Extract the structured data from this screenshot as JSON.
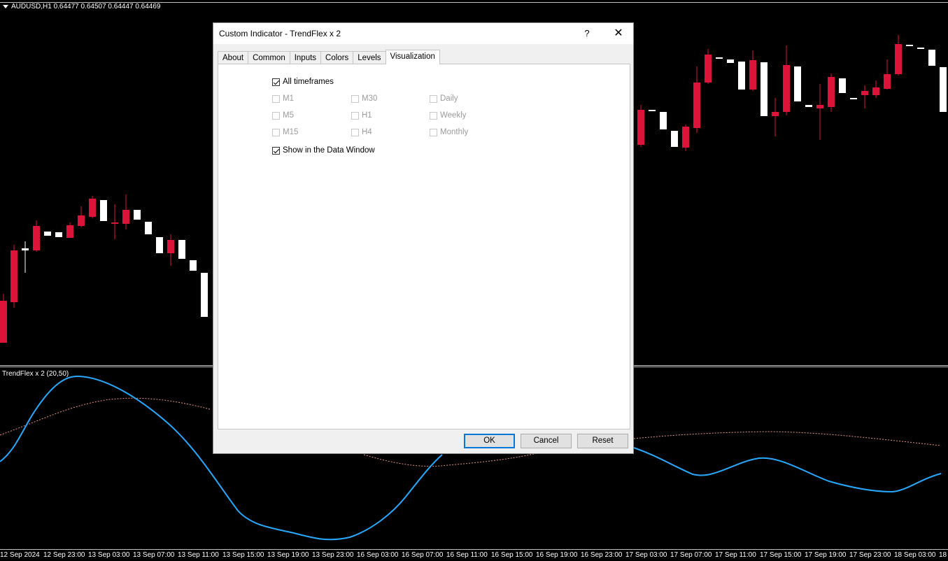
{
  "chart": {
    "symbol_label": "AUDUSD,H1  0.64477 0.64507 0.64447 0.64469",
    "indicator_label": "TrendFlex x 2 (20,50)",
    "x_ticks": [
      "12 Sep 2024",
      "12 Sep 23:00",
      "13 Sep 03:00",
      "13 Sep 07:00",
      "13 Sep 11:00",
      "13 Sep 15:00",
      "13 Sep 19:00",
      "13 Sep 23:00",
      "16 Sep 03:00",
      "16 Sep 07:00",
      "16 Sep 11:00",
      "16 Sep 15:00",
      "16 Sep 19:00",
      "16 Sep 23:00",
      "17 Sep 03:00",
      "17 Sep 07:00",
      "17 Sep 11:00",
      "17 Sep 15:00",
      "17 Sep 19:00",
      "17 Sep 23:00",
      "18 Sep 03:00",
      "18"
    ],
    "colors": {
      "bull": "#ffffff",
      "bear": "#dc143c",
      "line1": "#1e90ff",
      "line2": "#e9967a",
      "background": "#000000"
    }
  },
  "dialog": {
    "title": "Custom Indicator - TrendFlex x 2",
    "help_label": "?",
    "close_label": "✕",
    "tabs": [
      {
        "label": "About"
      },
      {
        "label": "Common"
      },
      {
        "label": "Inputs"
      },
      {
        "label": "Colors"
      },
      {
        "label": "Levels"
      },
      {
        "label": "Visualization",
        "active": true
      }
    ],
    "all_timeframes": {
      "label": "All timeframes",
      "checked": true
    },
    "timeframes": [
      {
        "label": "M1",
        "checked": false
      },
      {
        "label": "M5",
        "checked": false
      },
      {
        "label": "M15",
        "checked": false
      },
      {
        "label": "M30",
        "checked": false
      },
      {
        "label": "H1",
        "checked": false
      },
      {
        "label": "H4",
        "checked": false
      },
      {
        "label": "Daily",
        "checked": false
      },
      {
        "label": "Weekly",
        "checked": false
      },
      {
        "label": "Monthly",
        "checked": false
      }
    ],
    "show_data_window": {
      "label": "Show in the Data Window",
      "checked": true
    },
    "buttons": {
      "ok": "OK",
      "cancel": "Cancel",
      "reset": "Reset"
    }
  }
}
